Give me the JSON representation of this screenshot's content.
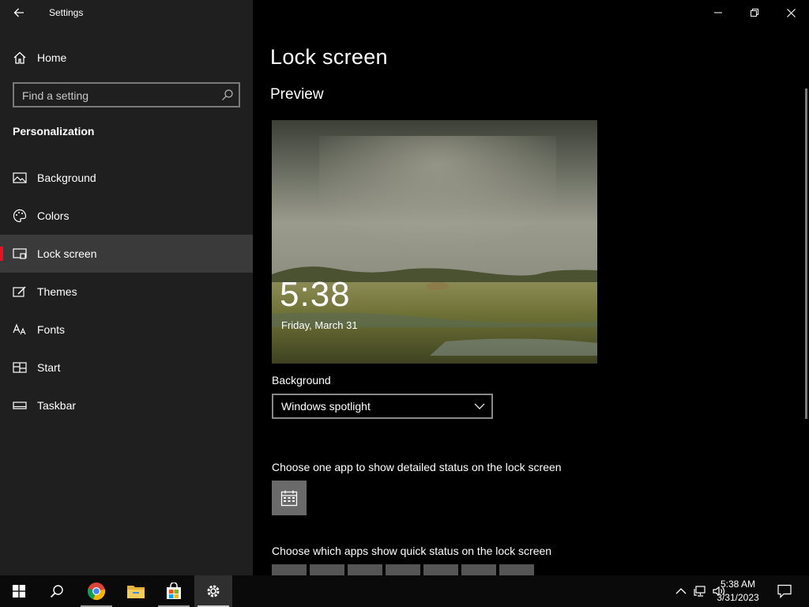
{
  "window": {
    "title": "Settings",
    "controls": {
      "minimize": "minimize",
      "restore": "restore",
      "close": "close"
    }
  },
  "sidebar": {
    "home_label": "Home",
    "search_placeholder": "Find a setting",
    "section_title": "Personalization",
    "items": [
      {
        "label": "Background",
        "icon": "image-icon"
      },
      {
        "label": "Colors",
        "icon": "palette-icon"
      },
      {
        "label": "Lock screen",
        "icon": "lock-screen-icon",
        "selected": true
      },
      {
        "label": "Themes",
        "icon": "themes-icon"
      },
      {
        "label": "Fonts",
        "icon": "fonts-icon"
      },
      {
        "label": "Start",
        "icon": "start-icon"
      },
      {
        "label": "Taskbar",
        "icon": "taskbar-icon"
      }
    ]
  },
  "main": {
    "page_title": "Lock screen",
    "preview_heading": "Preview",
    "preview": {
      "time": "5:38",
      "date": "Friday, March 31"
    },
    "background_label": "Background",
    "background_value": "Windows spotlight",
    "detail_status_label": "Choose one app to show detailed status on the lock screen",
    "quick_status_label": "Choose which apps show quick status on the lock screen"
  },
  "taskbar": {
    "apps": [
      "start-icon",
      "search-icon",
      "chrome-icon",
      "file-explorer-icon",
      "store-icon",
      "settings-icon"
    ],
    "clock_time": "5:38 AM",
    "clock_date": "3/31/2023"
  },
  "colors": {
    "accent": "#e81123",
    "sidebar_bg": "#1f1f1f",
    "selected_bg": "#3a3a3a"
  }
}
